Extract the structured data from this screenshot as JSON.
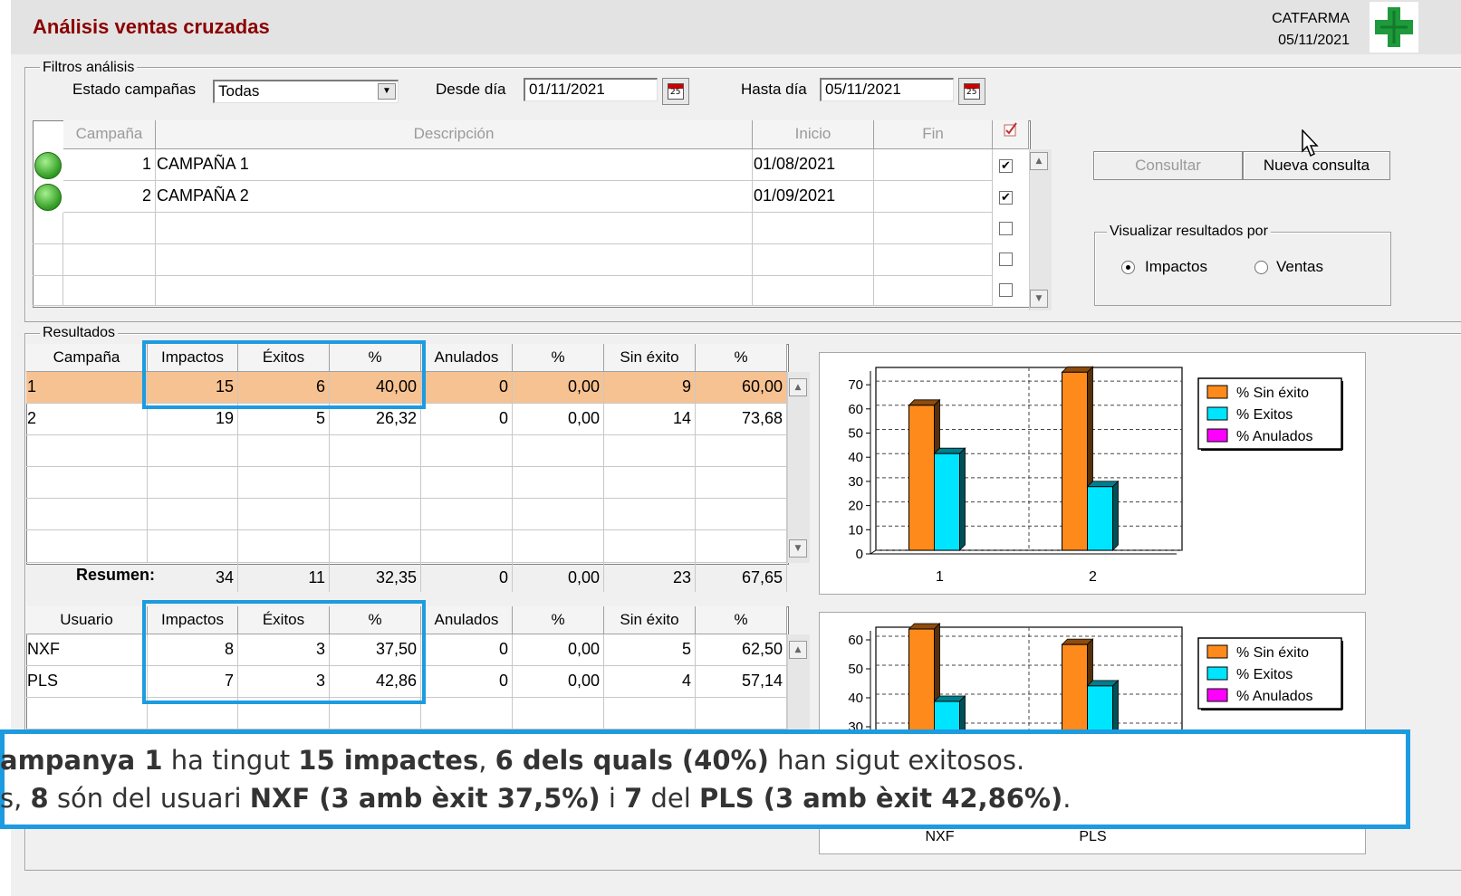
{
  "window": {
    "title": "Análisis ventas cruzadas",
    "company": "CATFARMA",
    "date": "05/11/2021"
  },
  "filters": {
    "group_label": "Filtros análisis",
    "estado_label": "Estado campañas",
    "estado_value": "Todas",
    "desde_label": "Desde día",
    "desde_value": "01/11/2021",
    "hasta_label": "Hasta día",
    "hasta_value": "05/11/2021"
  },
  "campaigns": {
    "headers": [
      "Campaña",
      "Descripción",
      "Inicio",
      "Fin"
    ],
    "rows": [
      {
        "id": "1",
        "desc": "CAMPAÑA 1",
        "inicio": "01/08/2021",
        "fin": "",
        "checked": true
      },
      {
        "id": "2",
        "desc": "CAMPAÑA 2",
        "inicio": "01/09/2021",
        "fin": "",
        "checked": true
      }
    ]
  },
  "actions": {
    "consultar": "Consultar",
    "nueva": "Nueva consulta"
  },
  "visualizar": {
    "label": "Visualizar resultados por",
    "impactos": "Impactos",
    "ventas": "Ventas",
    "selected": "Impactos"
  },
  "results": {
    "group_label": "Resultados",
    "camp_headers": [
      "Campaña",
      "Impactos",
      "Éxitos",
      "%",
      "Anulados",
      "%",
      "Sin éxito",
      "%"
    ],
    "camp_rows": [
      [
        "1",
        "15",
        "6",
        "40,00",
        "0",
        "0,00",
        "9",
        "60,00"
      ],
      [
        "2",
        "19",
        "5",
        "26,32",
        "0",
        "0,00",
        "14",
        "73,68"
      ]
    ],
    "summary_label": "Resumen:",
    "summary": [
      "34",
      "11",
      "32,35",
      "0",
      "0,00",
      "23",
      "67,65"
    ],
    "user_headers": [
      "Usuario",
      "Impactos",
      "Éxitos",
      "%",
      "Anulados",
      "%",
      "Sin éxito",
      "%"
    ],
    "user_rows": [
      [
        "NXF",
        "8",
        "3",
        "37,50",
        "0",
        "0,00",
        "5",
        "62,50"
      ],
      [
        "PLS",
        "7",
        "3",
        "42,86",
        "0",
        "0,00",
        "4",
        "57,14"
      ]
    ]
  },
  "chart_data": [
    {
      "type": "bar",
      "categories": [
        "1",
        "2"
      ],
      "series": [
        {
          "name": "% Sin éxito",
          "values": [
            60.0,
            73.68
          ],
          "color": "#ff8a1c"
        },
        {
          "name": "% Exitos",
          "values": [
            40.0,
            26.32
          ],
          "color": "#00e5ff"
        },
        {
          "name": "% Anulados",
          "values": [
            0,
            0
          ],
          "color": "#ff00ff"
        }
      ],
      "ylim": [
        0,
        73.68
      ],
      "yticks": [
        0,
        10,
        20,
        30,
        40,
        50,
        60,
        70
      ],
      "grid": true,
      "legend": "top-right"
    },
    {
      "type": "bar",
      "categories": [
        "NXF",
        "PLS"
      ],
      "series": [
        {
          "name": "% Sin éxito",
          "values": [
            62.5,
            57.14
          ],
          "color": "#ff8a1c"
        },
        {
          "name": "% Exitos",
          "values": [
            37.5,
            42.86
          ],
          "color": "#00e5ff"
        },
        {
          "name": "% Anulados",
          "values": [
            0,
            0
          ],
          "color": "#ff00ff"
        }
      ],
      "ylim": [
        0,
        62.5
      ],
      "yticks": [
        30,
        40,
        50,
        60
      ],
      "grid": true,
      "legend": "top-right"
    }
  ],
  "banner": {
    "l1a": "ampanya 1",
    "l1b": " ha tingut ",
    "l1c": "15 impactes",
    "l1d": ", ",
    "l1e": "6 dels quals  (40%)",
    "l1f": " han sigut exitosos.",
    "l2a": "s, ",
    "l2b": "8",
    "l2c": " són del usuari ",
    "l2d": "NXF (3 amb èxit 37,5%)",
    "l2e": " i ",
    "l2f": "7",
    "l2g": " del ",
    "l2h": "PLS (3 amb èxit 42,86%)",
    "l2i": "."
  }
}
